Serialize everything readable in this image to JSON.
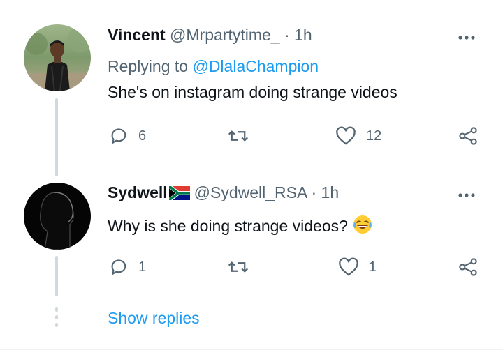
{
  "tweets": [
    {
      "name": "Vincent",
      "handle": "@Mrpartytime_",
      "separator": "·",
      "time": "1h",
      "replying_prefix": "Replying to ",
      "replying_to": "@DlalaChampion",
      "text": "She's on instagram doing strange videos",
      "replies": "6",
      "retweets": "",
      "likes": "12"
    },
    {
      "name": "Sydwell",
      "handle": "@Sydwell_RSA",
      "separator": "·",
      "time": "1h",
      "text": "Why is she doing strange videos?",
      "replies": "1",
      "retweets": "",
      "likes": "1"
    }
  ],
  "show_replies": "Show replies",
  "colors": {
    "accent": "#1d9bf0",
    "secondary_text": "#536471",
    "primary_text": "#0f1419",
    "thread_line": "#cfd9de"
  }
}
